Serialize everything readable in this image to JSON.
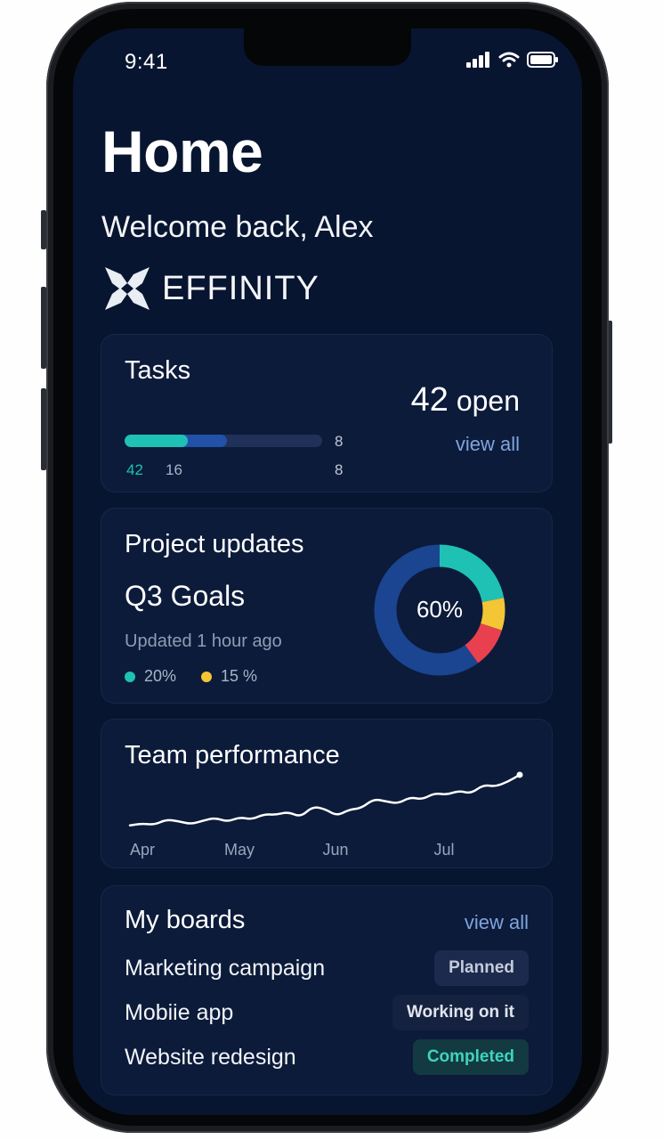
{
  "status_bar": {
    "time": "9:41"
  },
  "header": {
    "title": "Home",
    "welcome": "Welcome back, Alex"
  },
  "brand": {
    "name": "EFFINITY",
    "icon": "effinity-logo-icon"
  },
  "tasks": {
    "title": "Tasks",
    "open_count": "42",
    "open_suffix": "open",
    "view_all": "view all",
    "bar_top_right": "8",
    "bar_labels": {
      "first": "42",
      "second": "16",
      "third": "8"
    },
    "progress": {
      "teal_fraction": 0.32,
      "blue_fraction": 0.52
    }
  },
  "projects": {
    "title": "Project updates",
    "goal": "Q3 Goals",
    "updated": "Updated 1 hour ago",
    "donut_center": "60%",
    "legend": [
      {
        "label": "20%",
        "color": "#1fc1b4"
      },
      {
        "label": "15 %",
        "color": "#f4c534"
      }
    ],
    "donut_segments": [
      {
        "color": "#1fc1b4",
        "fraction": 0.22
      },
      {
        "color": "#f4c534",
        "fraction": 0.08
      },
      {
        "color": "#e8404e",
        "fraction": 0.1
      },
      {
        "color": "#1b4491",
        "fraction": 0.6
      }
    ]
  },
  "team": {
    "title": "Team performance",
    "months": [
      "Apr",
      "May",
      "Jun",
      "Jul"
    ],
    "trend": [
      8,
      11,
      9,
      18,
      15,
      10,
      16,
      21,
      14,
      22,
      18,
      27,
      26,
      31,
      22,
      40,
      36,
      24,
      35,
      37,
      53,
      49,
      45,
      56,
      52,
      63,
      60,
      67,
      62,
      77,
      74,
      82,
      94
    ]
  },
  "boards": {
    "title": "My boards",
    "view_all": "view all",
    "items": [
      {
        "name": "Marketing campaign",
        "status": "Planned",
        "bg": "#1c2a4d",
        "fg": "#c4ccdb"
      },
      {
        "name": "Mobiie app",
        "status": "Working on it",
        "bg": "#15223f",
        "fg": "#e0e4ee"
      },
      {
        "name": "Website redesign",
        "status": "Completed",
        "bg": "#123a40",
        "fg": "#3fd3bf"
      }
    ]
  },
  "colors": {
    "background": "#081530",
    "card": "#0c1b3a",
    "teal": "#1fc1b4",
    "blue": "#2152a8",
    "link": "#7fa4dc"
  }
}
